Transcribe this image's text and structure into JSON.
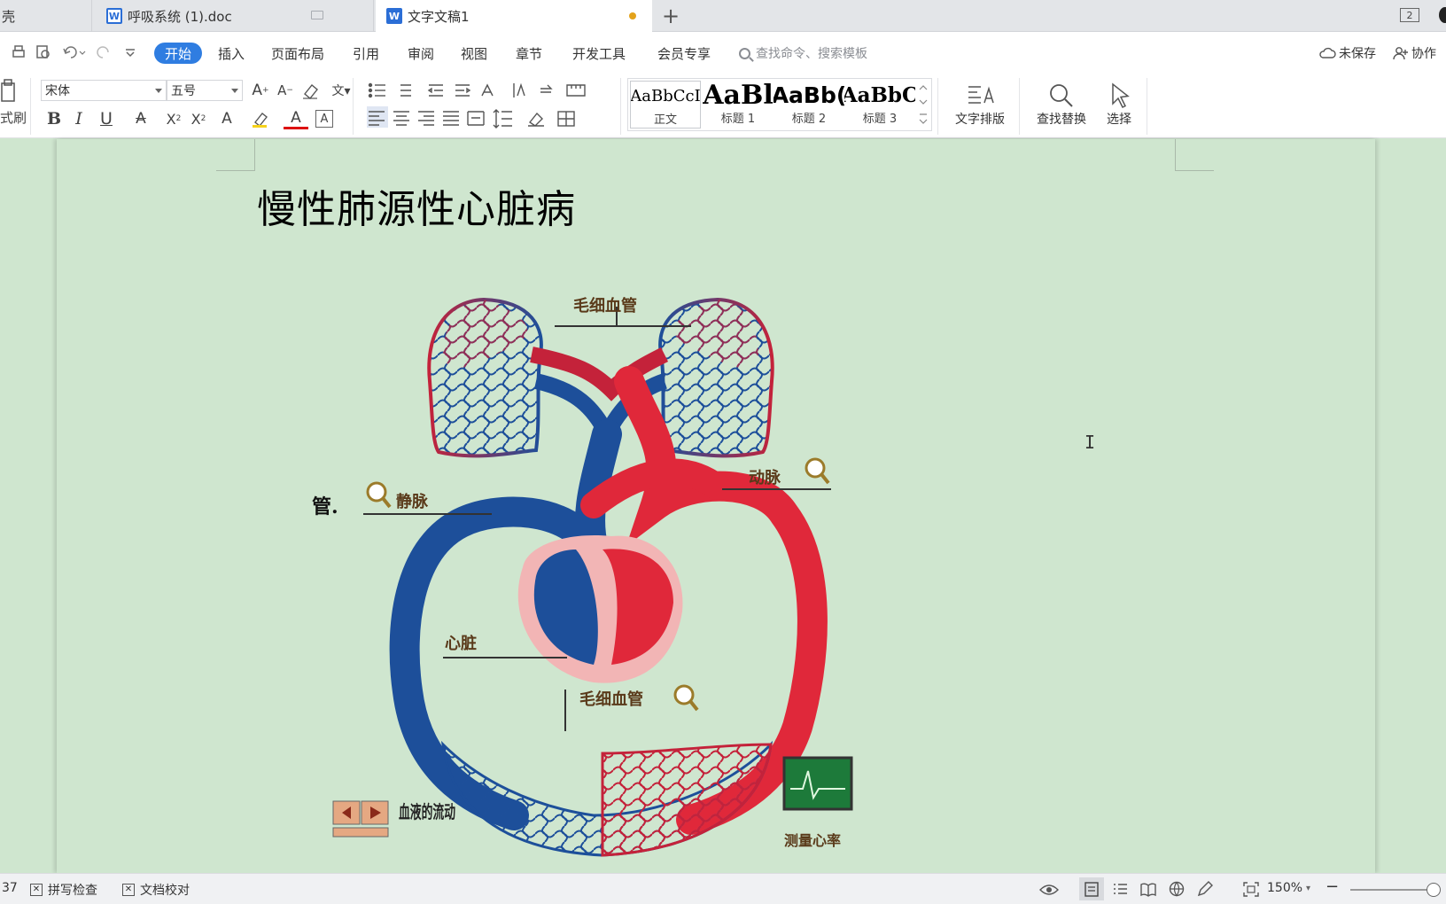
{
  "tabs": [
    {
      "label": "壳"
    },
    {
      "label": "呼吸系统 (1).doc"
    },
    {
      "label": "文字文稿1"
    }
  ],
  "window_badge": "2",
  "menu": {
    "items": [
      "开始",
      "插入",
      "页面布局",
      "引用",
      "审阅",
      "视图",
      "章节",
      "开发工具",
      "会员专享"
    ],
    "active": "开始",
    "search_placeholder": "查找命令、搜索模板",
    "unsaved": "未保存",
    "collab": "协作"
  },
  "ribbon": {
    "format_painter": "式刷",
    "font_name": "宋体",
    "font_size": "五号",
    "styles": [
      {
        "sample": "AaBbCcI",
        "name": "正文"
      },
      {
        "sample": "AaBl",
        "name": "标题 1"
      },
      {
        "sample": "AaBb(",
        "name": "标题 2"
      },
      {
        "sample": "AaBbC",
        "name": "标题 3"
      }
    ],
    "text_layout": "文字排版",
    "find_replace": "查找替换",
    "select": "选择"
  },
  "document": {
    "title": "慢性肺源性心脏病",
    "left_fragment": "管.",
    "figure_labels": {
      "capillary_top": "毛细血管",
      "artery": "动脉",
      "vein": "静脉",
      "heart": "心脏",
      "capillary_bottom": "毛细血管",
      "blood_flow": "血液的流动",
      "heart_rate": "测量心率"
    }
  },
  "status": {
    "page_count": "37",
    "spell_check": "拼写检查",
    "doc_proof": "文档校对",
    "zoom": "150%"
  },
  "colors": {
    "accent": "#2f7de1",
    "page_bg": "#cfe6cf",
    "artery": "#e0283a",
    "vein": "#1a5fa8"
  }
}
